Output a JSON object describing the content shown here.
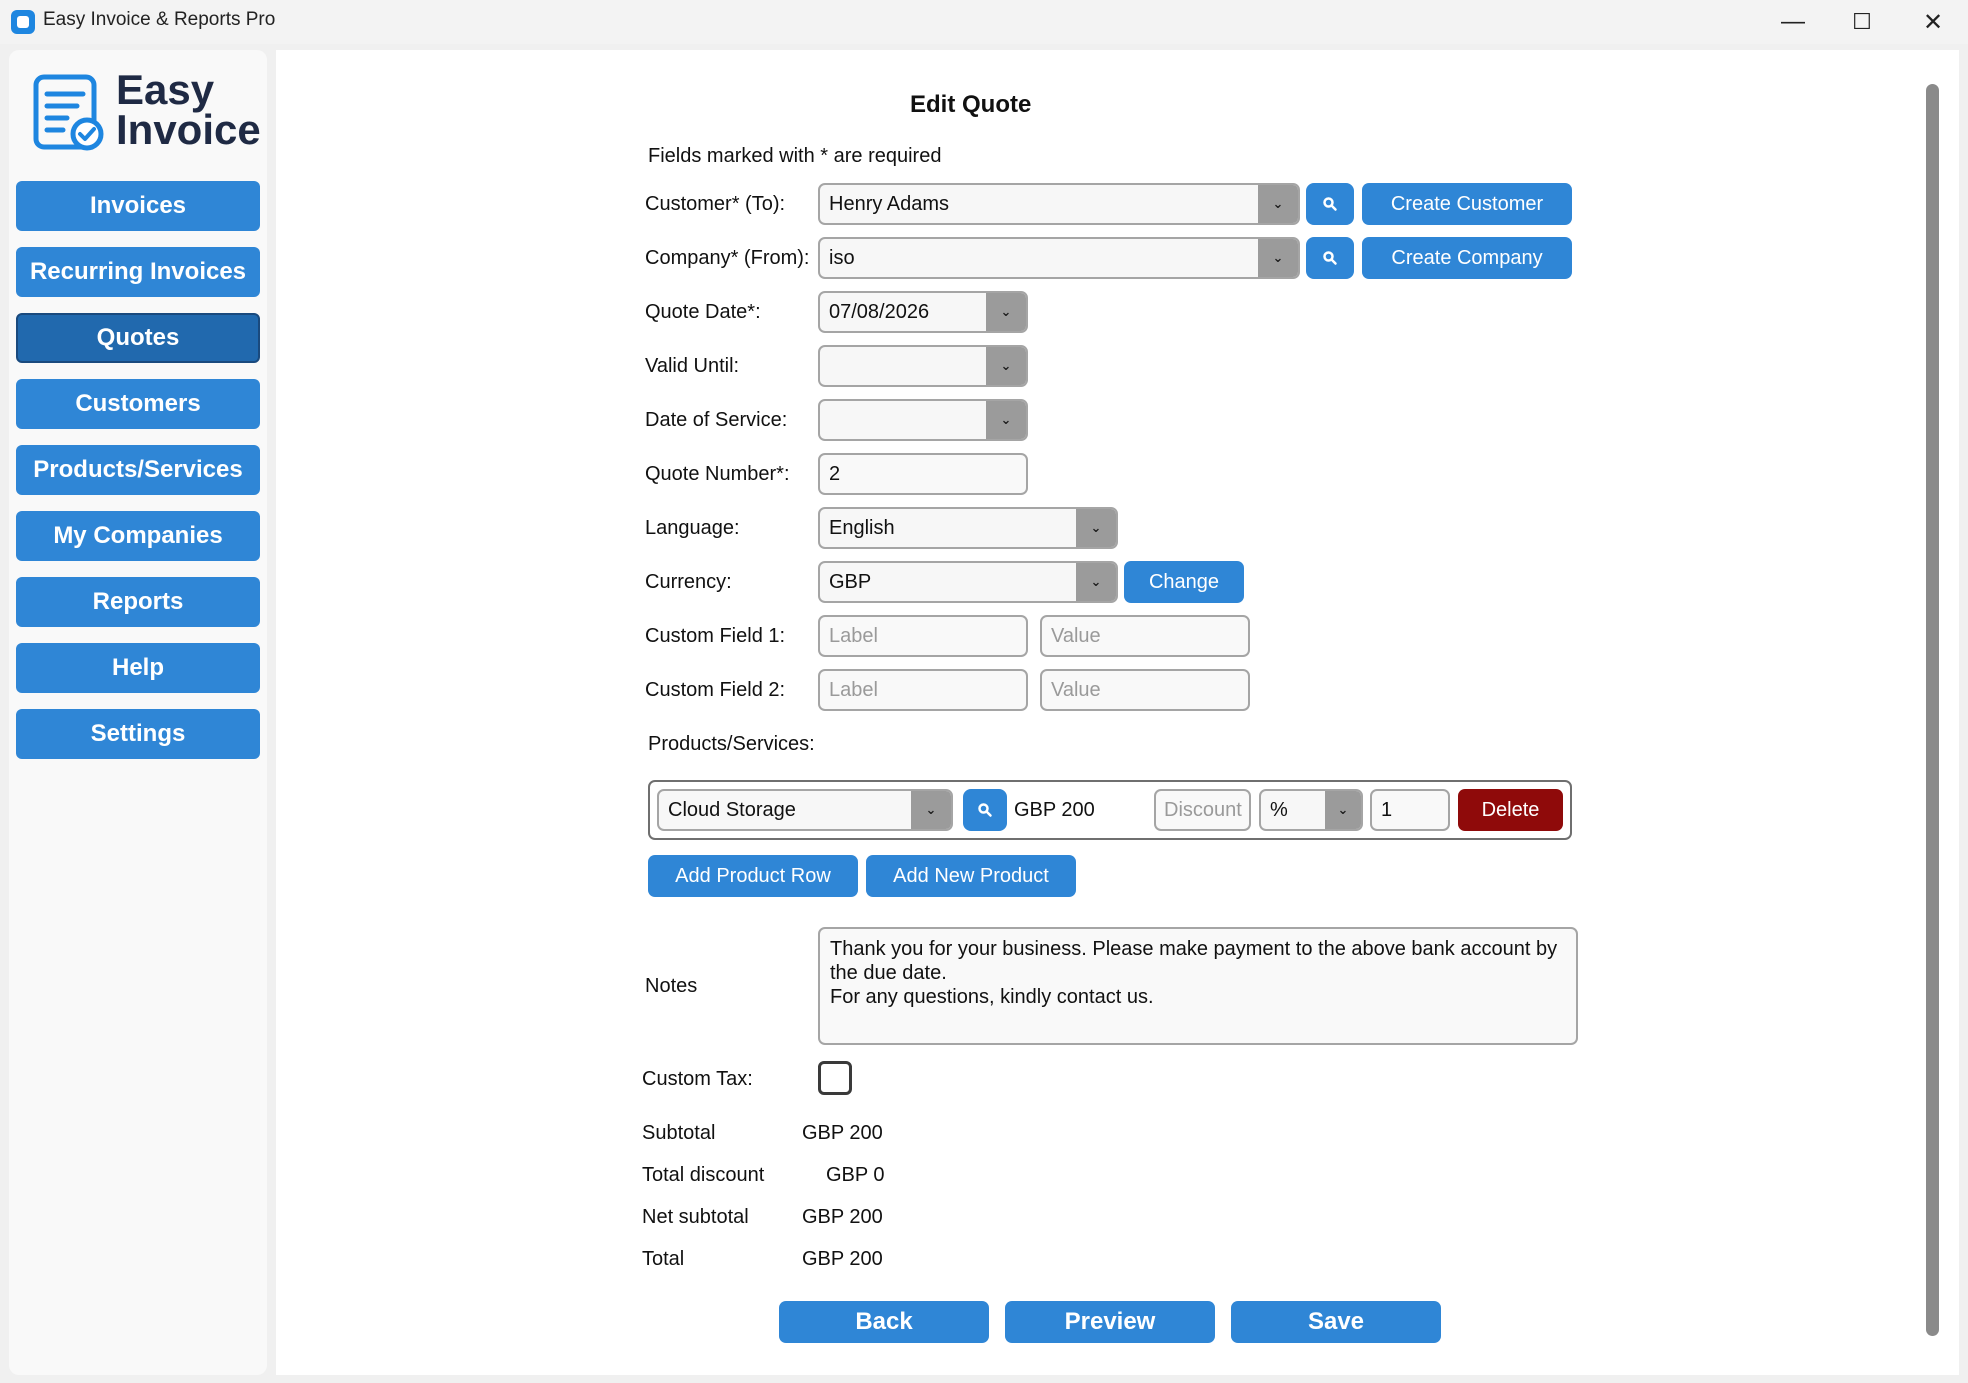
{
  "window": {
    "title": "Easy Invoice & Reports Pro",
    "minimize": "—",
    "maximize": "☐",
    "close": "✕"
  },
  "logo": {
    "line1": "Easy",
    "line2": "Invoice"
  },
  "sidebar": {
    "items": [
      {
        "label": "Invoices"
      },
      {
        "label": "Recurring Invoices"
      },
      {
        "label": "Quotes",
        "active": true
      },
      {
        "label": "Customers"
      },
      {
        "label": "Products/Services"
      },
      {
        "label": "My Companies"
      },
      {
        "label": "Reports"
      },
      {
        "label": "Help"
      },
      {
        "label": "Settings"
      }
    ]
  },
  "form": {
    "title": "Edit Quote",
    "required_note": "Fields marked with * are required",
    "customer": {
      "label": "Customer* (To):",
      "value": "Henry Adams",
      "create_label": "Create Customer"
    },
    "company": {
      "label": "Company* (From):",
      "value": "iso",
      "create_label": "Create Company"
    },
    "quote_date": {
      "label": "Quote Date*:",
      "value": "07/08/2026"
    },
    "valid_until": {
      "label": "Valid Until:",
      "value": ""
    },
    "date_of_service": {
      "label": "Date of Service:",
      "value": ""
    },
    "quote_number": {
      "label": "Quote Number*:",
      "value": "2"
    },
    "language": {
      "label": "Language:",
      "value": "English"
    },
    "currency": {
      "label": "Currency:",
      "value": "GBP",
      "change_label": "Change"
    },
    "custom_field_1": {
      "label": "Custom Field 1:",
      "label_placeholder": "Label",
      "value_placeholder": "Value"
    },
    "custom_field_2": {
      "label": "Custom Field 2:",
      "label_placeholder": "Label",
      "value_placeholder": "Value"
    },
    "products_label": "Products/Services:",
    "product_row": {
      "product": "Cloud Storage",
      "price": "GBP 200",
      "discount_placeholder": "Discount",
      "discount_type": "%",
      "quantity": "1",
      "delete_label": "Delete"
    },
    "add_row_label": "Add Product Row",
    "add_new_product_label": "Add New Product",
    "notes": {
      "label": "Notes",
      "value": "Thank you for your business. Please make payment to the above bank account by\nthe due date.\nFor any questions, kindly contact us."
    },
    "custom_tax": {
      "label": "Custom Tax:",
      "checked": false
    }
  },
  "summary": {
    "subtotal": {
      "label": "Subtotal",
      "value": "GBP 200"
    },
    "total_discount": {
      "label": "Total discount",
      "value": "GBP 0"
    },
    "net_subtotal": {
      "label": "Net subtotal",
      "value": "GBP 200"
    },
    "total": {
      "label": "Total",
      "value": "GBP 200"
    }
  },
  "actions": {
    "back": "Back",
    "preview": "Preview",
    "save": "Save"
  },
  "colors": {
    "primary": "#2f86d6",
    "active_nav": "#2169ae",
    "danger": "#8f0a0a",
    "sidebar_bg": "#f9f9f9",
    "content_bg": "#ffffff"
  }
}
